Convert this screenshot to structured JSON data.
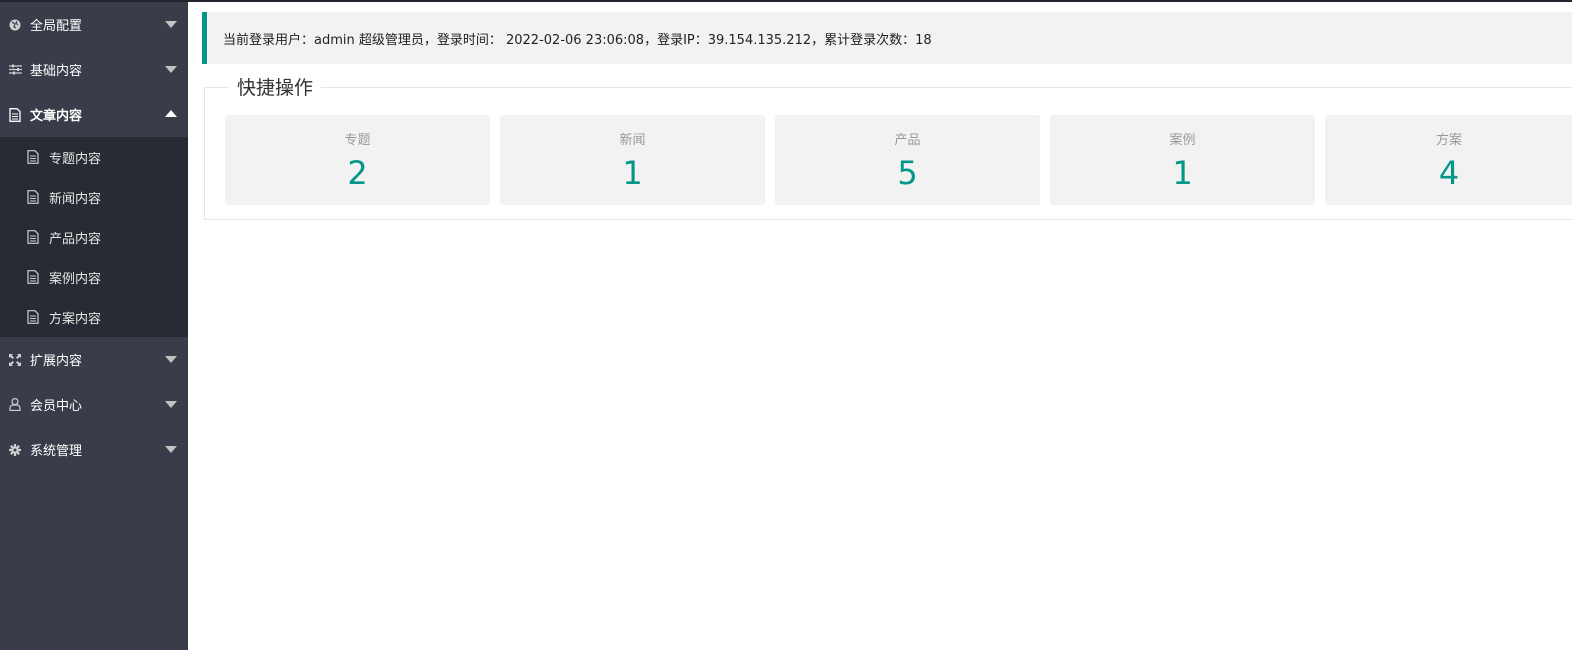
{
  "sidebar": {
    "items": [
      {
        "label": "全局配置",
        "icon": "globe-icon"
      },
      {
        "label": "基础内容",
        "icon": "sliders-icon"
      },
      {
        "label": "文章内容",
        "icon": "document-icon"
      },
      {
        "label": "扩展内容",
        "icon": "expand-icon"
      },
      {
        "label": "会员中心",
        "icon": "user-icon"
      },
      {
        "label": "系统管理",
        "icon": "gear-icon"
      }
    ],
    "article_sub": [
      {
        "label": "专题内容"
      },
      {
        "label": "新闻内容"
      },
      {
        "label": "产品内容"
      },
      {
        "label": "案例内容"
      },
      {
        "label": "方案内容"
      }
    ]
  },
  "info": {
    "text": "当前登录用户：admin 超级管理员，登录时间： 2022-02-06 23:06:08，登录IP：39.154.135.212，累计登录次数：18"
  },
  "quick": {
    "title": "快捷操作",
    "cards": [
      {
        "label": "专题",
        "count": "2"
      },
      {
        "label": "新闻",
        "count": "1"
      },
      {
        "label": "产品",
        "count": "5"
      },
      {
        "label": "案例",
        "count": "1"
      },
      {
        "label": "方案",
        "count": "4"
      }
    ]
  },
  "colors": {
    "sidebar_bg": "#393d49",
    "submenu_bg": "#282b33",
    "accent": "#009688"
  }
}
